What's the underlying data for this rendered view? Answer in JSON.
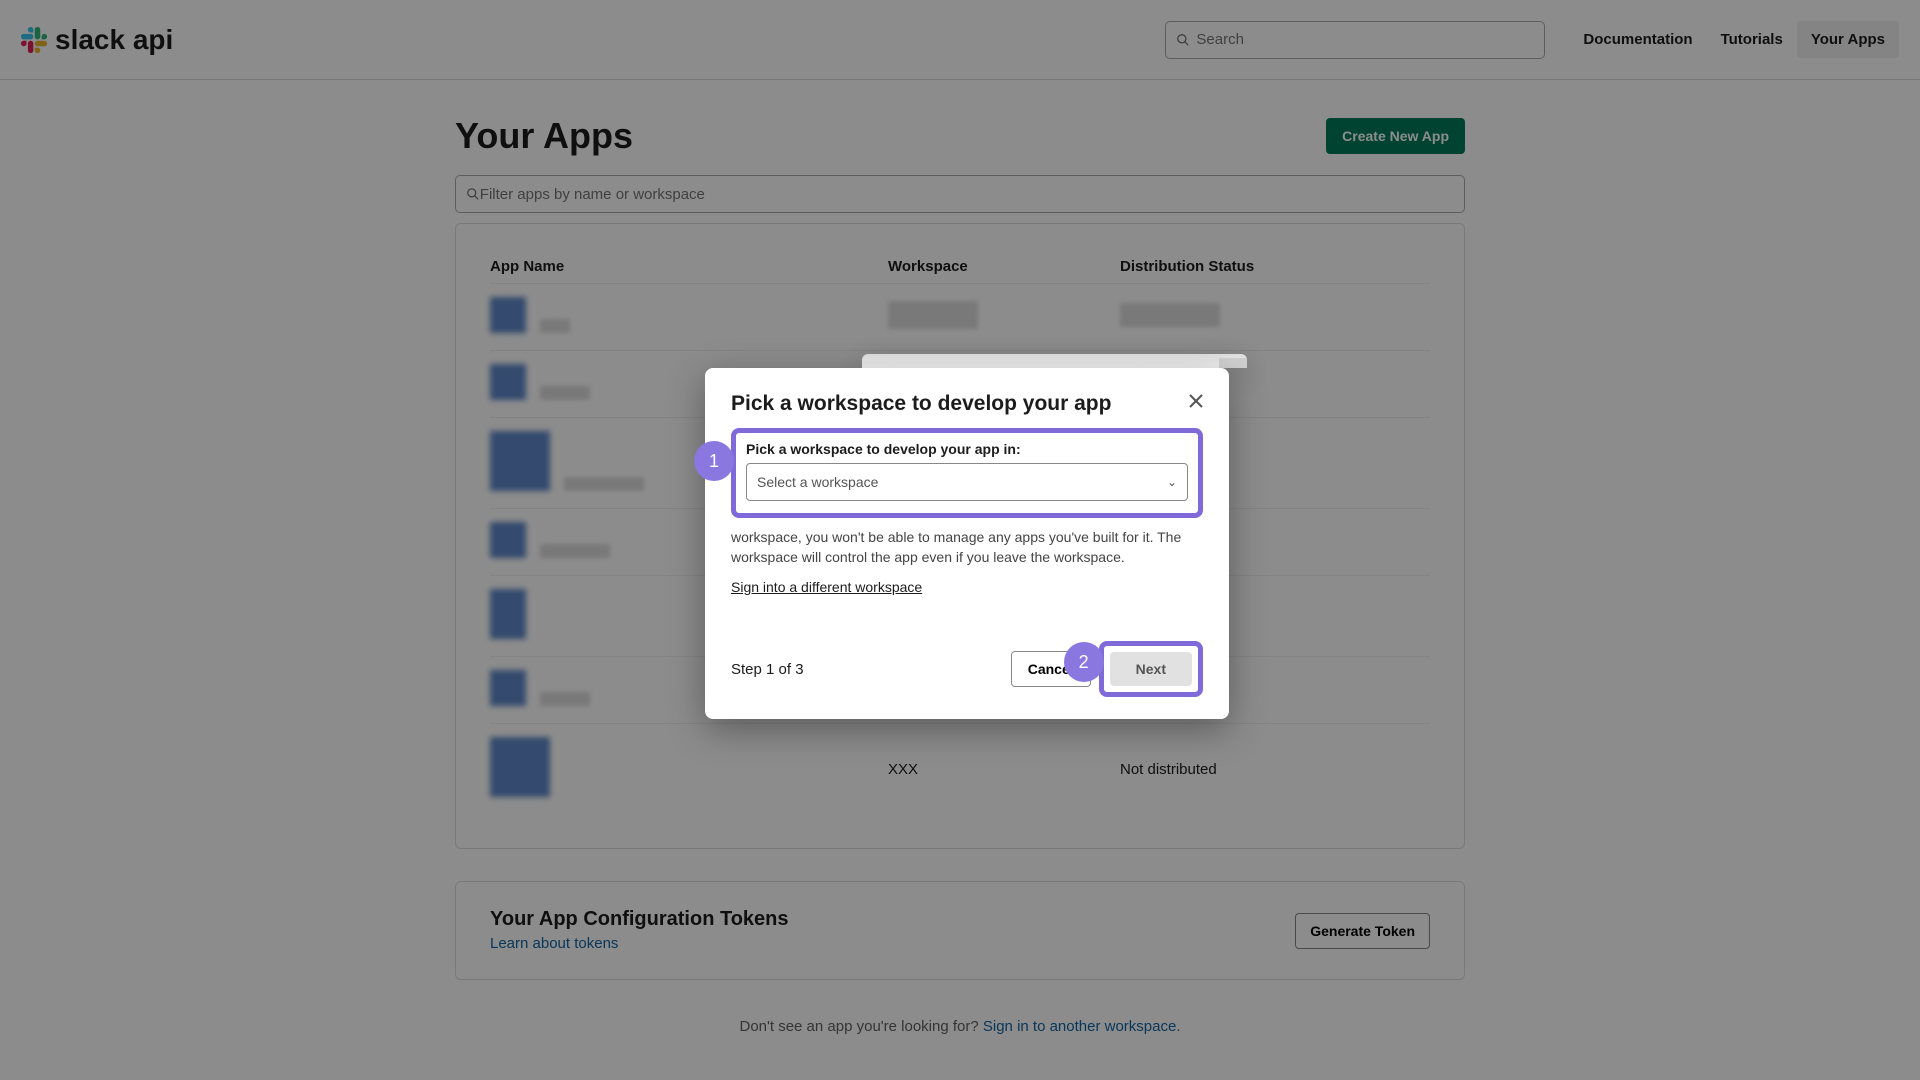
{
  "header": {
    "brand": "slack api",
    "search_placeholder": "Search",
    "nav": {
      "documentation": "Documentation",
      "tutorials": "Tutorials",
      "your_apps": "Your Apps"
    }
  },
  "main": {
    "title": "Your Apps",
    "create_button": "Create New App",
    "filter_placeholder": "Filter apps by name or workspace",
    "cols": {
      "name": "App Name",
      "workspace": "Workspace",
      "status": "Distribution Status"
    },
    "visible_row": {
      "workspace": "XXX",
      "status": "Not distributed"
    }
  },
  "tokens": {
    "title": "Your App Configuration Tokens",
    "learn": "Learn about tokens",
    "generate": "Generate Token"
  },
  "foot": {
    "text": "Don't see an app you're looking for? ",
    "link": "Sign in to another workspace"
  },
  "modal": {
    "title": "Pick a workspace to develop your app",
    "field_label": "Pick a workspace to develop your app in:",
    "select_placeholder": "Select a workspace",
    "help_text": "workspace, you won't be able to manage any apps you've built for it. The workspace will control the app even if you leave the workspace.",
    "diff_workspace": "Sign into a different workspace",
    "step": "Step 1 of 3",
    "cancel": "Cancel",
    "next": "Next",
    "badge1": "1",
    "badge2": "2"
  }
}
